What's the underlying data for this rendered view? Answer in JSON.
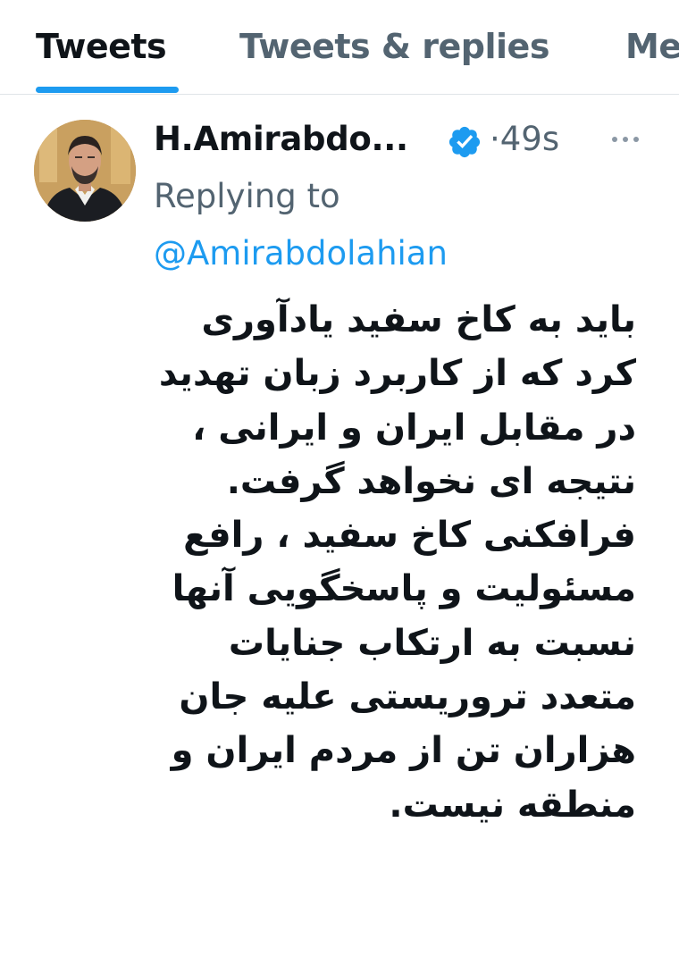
{
  "tabs": [
    {
      "label": "Tweets",
      "active": true
    },
    {
      "label": "Tweets & replies",
      "active": false
    },
    {
      "label": "Media",
      "active": false
    }
  ],
  "accent_color": "#1d9bf0",
  "tweet": {
    "display_name": "H.Amirabdo...",
    "verified": true,
    "time": "·49s",
    "replying_label": "Replying to",
    "replying_handle": "@Amirabdolahian",
    "paragraphs": [
      "باید به کاخ سفید یادآوری کرد که از کاربرد زبان تهدید در مقابل ایران و ایرانی ، نتیجه ای نخواهد گرفت.",
      "فرافکنی کاخ سفید ، رافع مسئولیت و پاسخگویی آنها نسبت به ارتکاب جنایات متعدد تروریستی علیه جان هزاران تن از مردم ایران و منطقه نیست."
    ]
  }
}
